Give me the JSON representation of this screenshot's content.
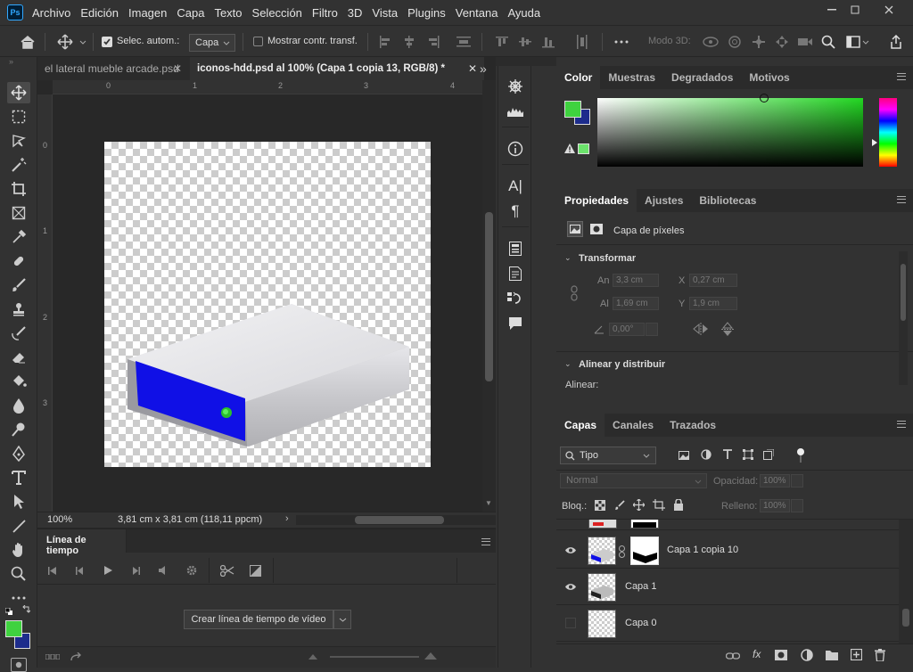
{
  "menu": [
    "Archivo",
    "Edición",
    "Imagen",
    "Capa",
    "Texto",
    "Selección",
    "Filtro",
    "3D",
    "Vista",
    "Plugins",
    "Ventana",
    "Ayuda"
  ],
  "options": {
    "auto_select_label": "Selec. autom.:",
    "auto_select_value": "Capa",
    "show_transform_label": "Mostrar contr. transf.",
    "mode3d_label": "Modo 3D:"
  },
  "tabs": [
    {
      "label": "el lateral mueble arcade.psd"
    },
    {
      "label": "iconos-hdd.psd al 100% (Capa 1 copia 13, RGB/8) *"
    }
  ],
  "ruler": {
    "h": [
      "0",
      "1",
      "2",
      "3",
      "4"
    ],
    "v": [
      "0",
      "1",
      "2",
      "3"
    ]
  },
  "status": {
    "zoom": "100%",
    "doc_info": "3,81 cm x 3,81 cm (118,11 ppcm)"
  },
  "timeline": {
    "title": "Línea de tiempo",
    "create_button": "Crear línea de tiempo de vídeo"
  },
  "color_panel": {
    "tabs": [
      "Color",
      "Muestras",
      "Degradados",
      "Motivos"
    ],
    "fg_color": "#3fd23f",
    "bg_color": "#1d2c8c"
  },
  "properties": {
    "tabs": [
      "Propiedades",
      "Ajustes",
      "Bibliotecas"
    ],
    "layer_type": "Capa de píxeles",
    "transform_title": "Transformar",
    "an_label": "An",
    "an_value": "3,3 cm",
    "x_label": "X",
    "x_value": "0,27 cm",
    "al_label": "Al",
    "al_value": "1,69 cm",
    "y_label": "Y",
    "y_value": "1,9 cm",
    "angle_value": "0,00°",
    "align_title": "Alinear y distribuir",
    "align_label": "Alinear:"
  },
  "layers_panel": {
    "tabs": [
      "Capas",
      "Canales",
      "Trazados"
    ],
    "filter_value": "Tipo",
    "blend_mode": "Normal",
    "opacity_label": "Opacidad:",
    "opacity_value": "100%",
    "lock_label": "Bloq.:",
    "fill_label": "Relleno:",
    "fill_value": "100%",
    "layers": [
      {
        "name": "Capa 1 copia 10"
      },
      {
        "name": "Capa 1"
      },
      {
        "name": "Capa 0"
      }
    ]
  }
}
